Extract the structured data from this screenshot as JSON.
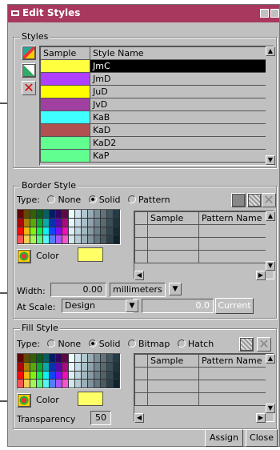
{
  "window": {
    "title": "Edit Styles"
  },
  "styles_section": {
    "label": "Styles",
    "headers": [
      "Sample",
      "Style Name"
    ],
    "rows": [
      {
        "name": "JmC",
        "color": "#ffff40",
        "selected": true
      },
      {
        "name": "JmD",
        "color": "#b040ff"
      },
      {
        "name": "JuD",
        "color": "#ffff00"
      },
      {
        "name": "JvD",
        "color": "#a040a0"
      },
      {
        "name": "KaB",
        "color": "#40ffff"
      },
      {
        "name": "KaD",
        "color": "#b05050"
      },
      {
        "name": "KaD2",
        "color": "#60ff90"
      },
      {
        "name": "KaP",
        "color": "#60ff90"
      }
    ]
  },
  "border_style": {
    "label": "Border Style",
    "type_label": "Type:",
    "options": [
      "None",
      "Solid",
      "Pattern"
    ],
    "selected": "Solid",
    "color_label": "Color",
    "color": "#ffff66",
    "headers": [
      "Sample",
      "Pattern Name"
    ],
    "width_label": "Width:",
    "width_value": "0.00",
    "units": "millimeters",
    "at_scale_label": "At Scale:",
    "at_scale_value": "Design",
    "scale_value": "0.0",
    "current_button": "Current"
  },
  "fill_style": {
    "label": "Fill Style",
    "type_label": "Type:",
    "options": [
      "None",
      "Solid",
      "Bitmap",
      "Hatch"
    ],
    "selected": "Solid",
    "color_label": "Color",
    "color": "#ffff66",
    "headers": [
      "Sample",
      "Pattern Name"
    ],
    "transparency_label": "Transparency",
    "transparency_value": "50"
  },
  "buttons": {
    "assign": "Assign",
    "close": "Close"
  }
}
